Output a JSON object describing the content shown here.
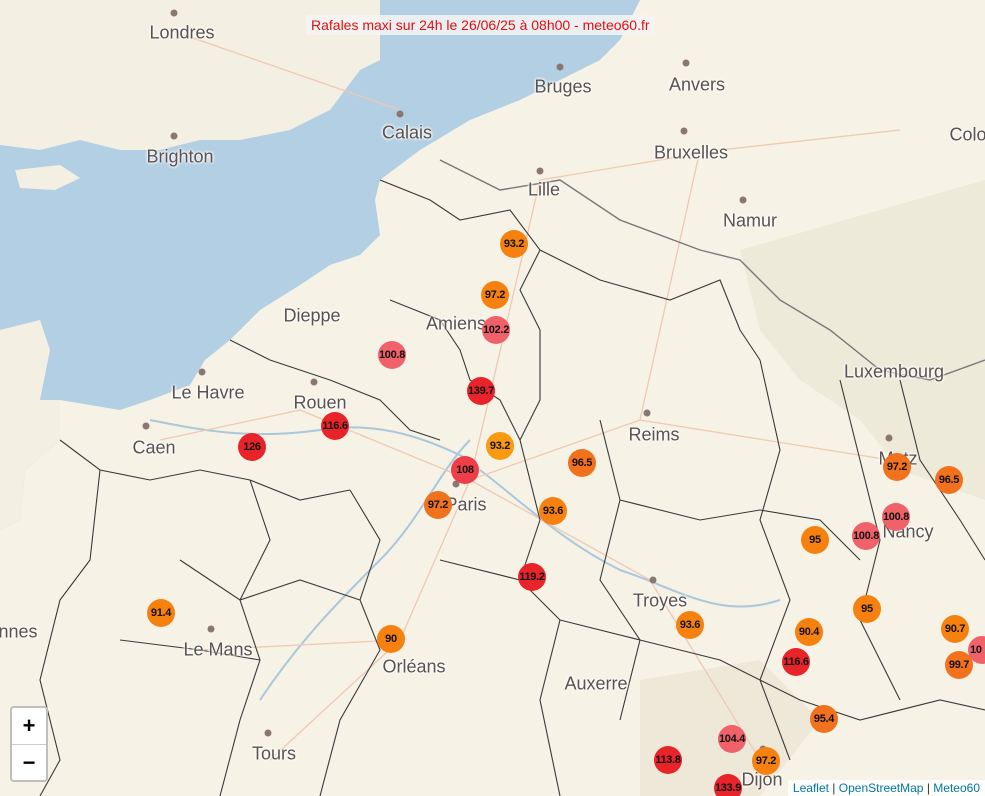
{
  "title": "Rafales maxi sur 24h le 26/06/25 à 08h00 - meteo60.fr",
  "zoom": {
    "in_label": "+",
    "out_label": "−"
  },
  "attribution": {
    "leaflet": "Leaflet",
    "sep": "|",
    "osm": "OpenStreetMap",
    "meteo": "Meteo60"
  },
  "colors": {
    "sea": "#b3cfe3",
    "land": "#f6f2e6",
    "border": "#333333",
    "marker_orange": "#f7810f",
    "marker_red": "#e8232a",
    "title_text": "#e01010"
  },
  "cities": [
    {
      "name": "Londres",
      "dot": true
    },
    {
      "name": "Bruges",
      "dot": true
    },
    {
      "name": "Anvers",
      "dot": true
    },
    {
      "name": "Calais",
      "dot": true
    },
    {
      "name": "Brighton",
      "dot": true
    },
    {
      "name": "Bruxelles",
      "dot": true
    },
    {
      "name": "Colo",
      "dot": false
    },
    {
      "name": "Lille",
      "dot": true
    },
    {
      "name": "Namur",
      "dot": true
    },
    {
      "name": "Dieppe",
      "dot": false
    },
    {
      "name": "Amiens",
      "dot": false
    },
    {
      "name": "Le Havre",
      "dot": true
    },
    {
      "name": "Luxembourg",
      "dot": false
    },
    {
      "name": "Rouen",
      "dot": true
    },
    {
      "name": "Caen",
      "dot": true
    },
    {
      "name": "Reims",
      "dot": true
    },
    {
      "name": "Metz",
      "dot": true
    },
    {
      "name": "Paris",
      "dot": true
    },
    {
      "name": "Nancy",
      "dot": false
    },
    {
      "name": "Troyes",
      "dot": true
    },
    {
      "name": "nnes",
      "dot": false
    },
    {
      "name": "Le Mans",
      "dot": true
    },
    {
      "name": "Orléans",
      "dot": false
    },
    {
      "name": "Auxerre",
      "dot": false
    },
    {
      "name": "Tours",
      "dot": true
    },
    {
      "name": "Dijon",
      "dot": true
    }
  ],
  "markers": [
    {
      "value": "93.2",
      "level": "orange"
    },
    {
      "value": "97.2",
      "level": "orange"
    },
    {
      "value": "102.2",
      "level": "pink"
    },
    {
      "value": "100.8",
      "level": "pink"
    },
    {
      "value": "139.7",
      "level": "red"
    },
    {
      "value": "116.6",
      "level": "red"
    },
    {
      "value": "126",
      "level": "red"
    },
    {
      "value": "93.2",
      "level": "yellow"
    },
    {
      "value": "108",
      "level": "redpink"
    },
    {
      "value": "96.5",
      "level": "orange2"
    },
    {
      "value": "97.2",
      "level": "orange2"
    },
    {
      "value": "93.6",
      "level": "orange"
    },
    {
      "value": "119.2",
      "level": "red"
    },
    {
      "value": "91.4",
      "level": "orange"
    },
    {
      "value": "90",
      "level": "orange"
    },
    {
      "value": "97.2",
      "level": "orange2"
    },
    {
      "value": "96.5",
      "level": "orange2"
    },
    {
      "value": "100.8",
      "level": "pink"
    },
    {
      "value": "95",
      "level": "orange"
    },
    {
      "value": "100.8",
      "level": "pink"
    },
    {
      "value": "95",
      "level": "orange"
    },
    {
      "value": "93.6",
      "level": "orange"
    },
    {
      "value": "90.4",
      "level": "orange"
    },
    {
      "value": "116.6",
      "level": "red"
    },
    {
      "value": "90.7",
      "level": "orange"
    },
    {
      "value": "99.7",
      "level": "orange2"
    },
    {
      "value": "10",
      "level": "pink"
    },
    {
      "value": "95.4",
      "level": "orange2"
    },
    {
      "value": "104.4",
      "level": "pink"
    },
    {
      "value": "97.2",
      "level": "orange"
    },
    {
      "value": "113.8",
      "level": "red"
    },
    {
      "value": "133.9",
      "level": "red"
    }
  ]
}
